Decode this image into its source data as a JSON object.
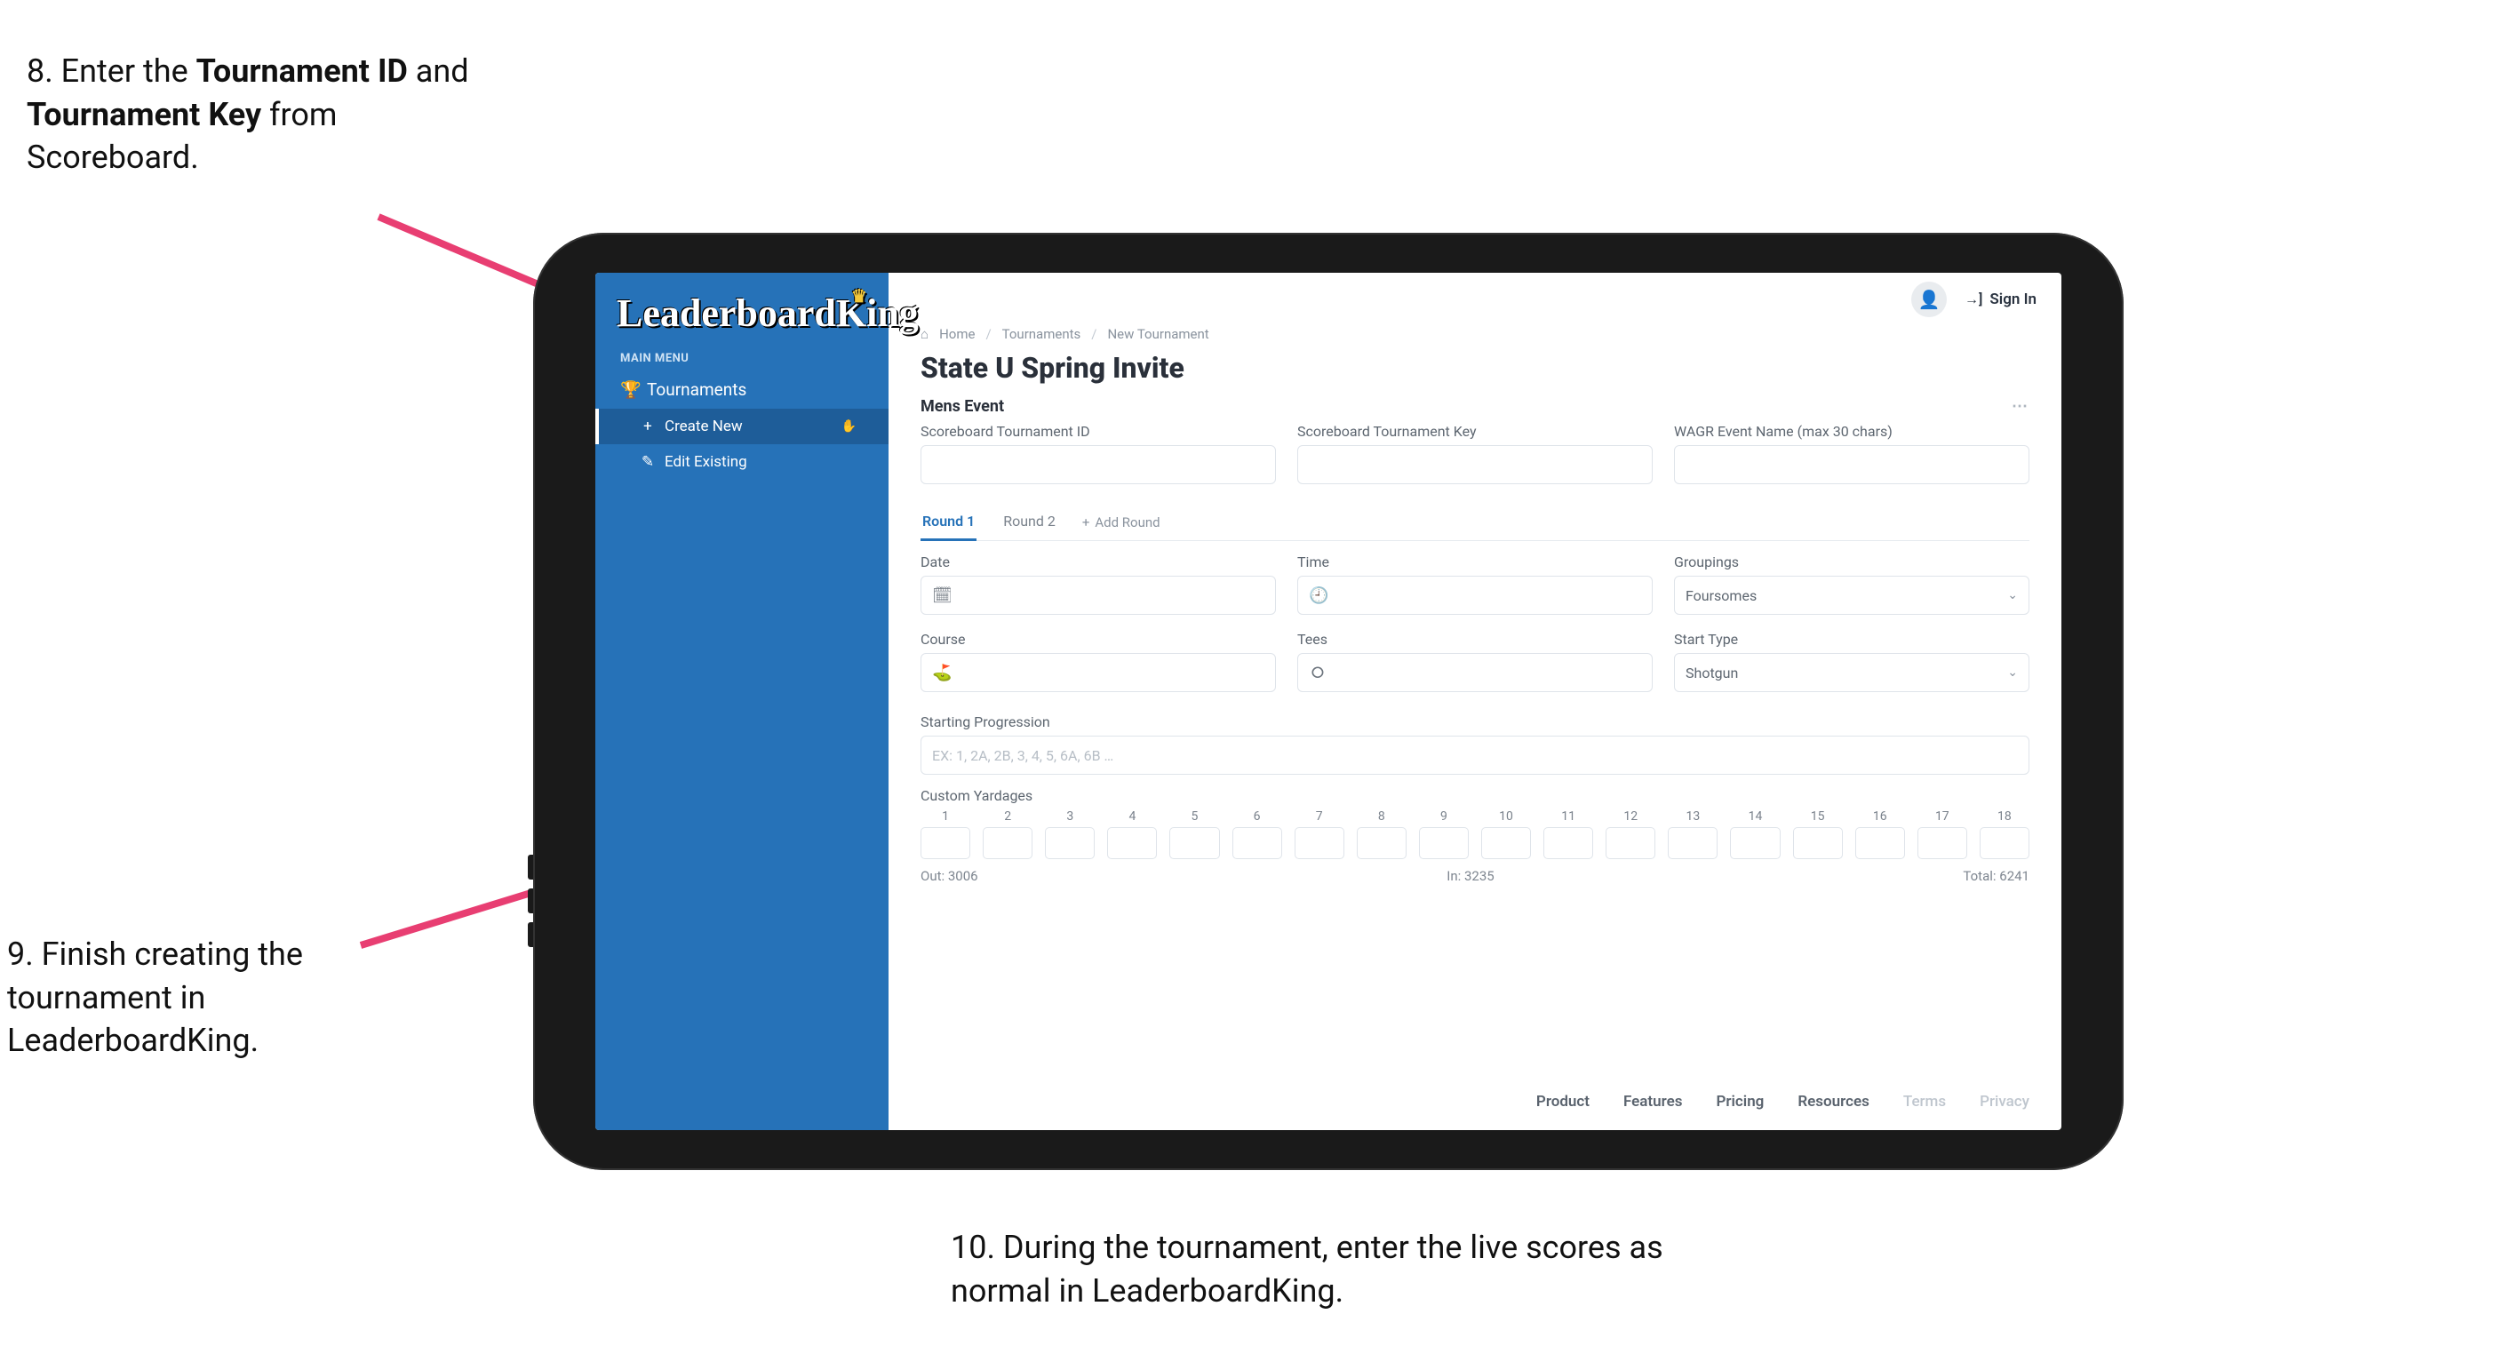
{
  "annotations": {
    "step8_prefix": "8. Enter the ",
    "step8_bold1": "Tournament ID",
    "step8_mid": " and ",
    "step8_bold2": "Tournament Key",
    "step8_suffix": " from Scoreboard.",
    "step9": "9. Finish creating the tournament in LeaderboardKing.",
    "step10": "10. During the tournament, enter the live scores as normal in LeaderboardKing."
  },
  "sidebar": {
    "logo_text": "LeaderboardKing",
    "main_menu_label": "MAIN MENU",
    "tournaments_label": "Tournaments",
    "create_new_label": "Create New",
    "edit_existing_label": "Edit Existing"
  },
  "topbar": {
    "signin_label": "Sign In"
  },
  "breadcrumb": {
    "home": "Home",
    "tournaments": "Tournaments",
    "new_tournament": "New Tournament"
  },
  "page": {
    "title": "State U Spring Invite",
    "section_title": "Mens Event"
  },
  "fields": {
    "scoreboard_id_label": "Scoreboard Tournament ID",
    "scoreboard_key_label": "Scoreboard Tournament Key",
    "wagr_label": "WAGR Event Name (max 30 chars)",
    "date_label": "Date",
    "time_label": "Time",
    "groupings_label": "Groupings",
    "groupings_value": "Foursomes",
    "course_label": "Course",
    "tees_label": "Tees",
    "start_type_label": "Start Type",
    "start_type_value": "Shotgun",
    "starting_prog_label": "Starting Progression",
    "starting_prog_placeholder": "EX: 1, 2A, 2B, 3, 4, 5, 6A, 6B …",
    "custom_yardages_label": "Custom Yardages"
  },
  "tabs": {
    "round1": "Round 1",
    "round2": "Round 2",
    "add_round": "Add Round"
  },
  "holes": [
    "1",
    "2",
    "3",
    "4",
    "5",
    "6",
    "7",
    "8",
    "9",
    "10",
    "11",
    "12",
    "13",
    "14",
    "15",
    "16",
    "17",
    "18"
  ],
  "yardage_summary": {
    "out_label": "Out:",
    "out_value": "3006",
    "in_label": "In:",
    "in_value": "3235",
    "total_label": "Total:",
    "total_value": "6241"
  },
  "footer": {
    "product": "Product",
    "features": "Features",
    "pricing": "Pricing",
    "resources": "Resources",
    "terms": "Terms",
    "privacy": "Privacy"
  }
}
